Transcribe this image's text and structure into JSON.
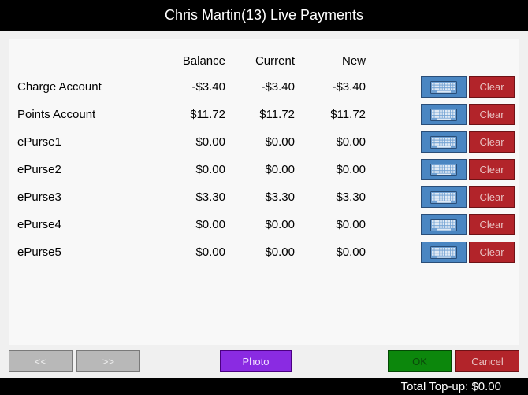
{
  "window": {
    "title": "Chris Martin(13) Live Payments"
  },
  "columns": {
    "balance": "Balance",
    "current": "Current",
    "new": "New"
  },
  "rows": [
    {
      "label": "Charge Account",
      "balance": "-$3.40",
      "current": "-$3.40",
      "new": "-$3.40",
      "clear": "Clear"
    },
    {
      "label": "Points Account",
      "balance": "$11.72",
      "current": "$11.72",
      "new": "$11.72",
      "clear": "Clear"
    },
    {
      "label": "ePurse1",
      "balance": "$0.00",
      "current": "$0.00",
      "new": "$0.00",
      "clear": "Clear"
    },
    {
      "label": "ePurse2",
      "balance": "$0.00",
      "current": "$0.00",
      "new": "$0.00",
      "clear": "Clear"
    },
    {
      "label": "ePurse3",
      "balance": "$3.30",
      "current": "$3.30",
      "new": "$3.30",
      "clear": "Clear"
    },
    {
      "label": "ePurse4",
      "balance": "$0.00",
      "current": "$0.00",
      "new": "$0.00",
      "clear": "Clear"
    },
    {
      "label": "ePurse5",
      "balance": "$0.00",
      "current": "$0.00",
      "new": "$0.00",
      "clear": "Clear"
    }
  ],
  "footer": {
    "prev": "<<",
    "next": ">>",
    "photo": "Photo",
    "ok": "OK",
    "cancel": "Cancel"
  },
  "status": {
    "total_topup": "Total Top-up: $0.00"
  },
  "icons": {
    "keypad": "keyboard-icon"
  },
  "colors": {
    "keypad_button": "#4a86c2",
    "clear_button": "#b2242a",
    "photo_button": "#8a2be2",
    "ok_button": "#0c870c",
    "nav_button": "#b8b8b8"
  }
}
